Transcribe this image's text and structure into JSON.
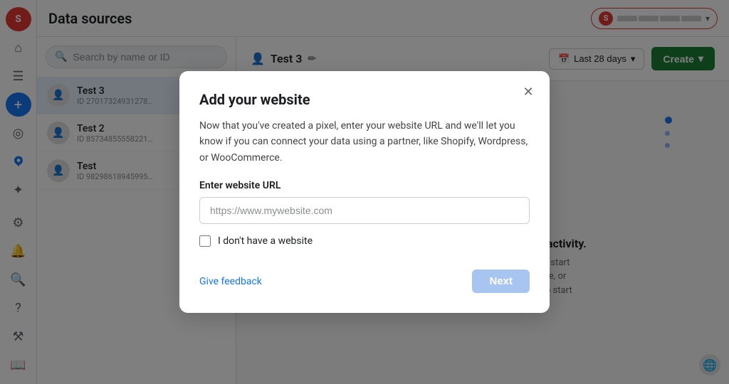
{
  "sidebar": {
    "avatar_label": "S",
    "items": [
      {
        "name": "home",
        "icon": "⌂"
      },
      {
        "name": "menu",
        "icon": "☰"
      },
      {
        "name": "add",
        "icon": "+"
      },
      {
        "name": "analytics",
        "icon": "◎"
      },
      {
        "name": "rocket",
        "icon": "▲"
      },
      {
        "name": "star",
        "icon": "✦"
      },
      {
        "name": "settings",
        "icon": "⚙"
      },
      {
        "name": "bell",
        "icon": "🔔"
      },
      {
        "name": "search",
        "icon": "🔍"
      },
      {
        "name": "help",
        "icon": "?"
      },
      {
        "name": "tools",
        "icon": "⚒"
      },
      {
        "name": "book",
        "icon": "📖"
      }
    ]
  },
  "topbar": {
    "title": "Data sources",
    "account": {
      "badge": "S",
      "segment1": "",
      "segment2": "",
      "segment3": "",
      "segment4": ""
    }
  },
  "search": {
    "placeholder": "Search by name or ID"
  },
  "datasources": [
    {
      "name": "Test 3",
      "id": "ID 27017324931278…",
      "active": true
    },
    {
      "name": "Test 2",
      "id": "ID 85734855558221…"
    },
    {
      "name": "Test",
      "id": "ID 98298618945995…"
    }
  ],
  "right_panel": {
    "selected_name": "Test 3",
    "date_range": "Last 28 days",
    "create_label": "Create",
    "empty_title": "Your dataset hasn't received any activity.",
    "empty_desc": "You haven't set up any integrations to start sending events from a server, website, or app. Finish setting up an integration to start seeing activity."
  },
  "modal": {
    "title": "Add your website",
    "description": "Now that you've created a pixel, enter your website URL and we'll let you know if you can connect your data using a partner, like Shopify, Wordpress, or WooCommerce.",
    "url_label": "Enter website URL",
    "url_placeholder": "https://www.mywebsite.com",
    "no_website_label": "I don't have a website",
    "feedback_label": "Give feedback",
    "next_label": "Next"
  }
}
